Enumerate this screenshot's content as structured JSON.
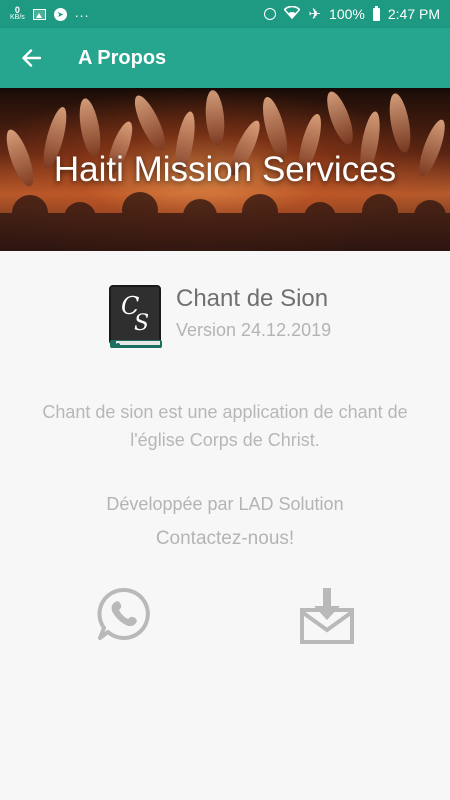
{
  "status_bar": {
    "kb_value": "0",
    "kb_unit": "KB/s",
    "more": "...",
    "battery": "100%",
    "time": "2:47 PM",
    "icons": [
      "network-speed-icon",
      "image-icon",
      "telegram-icon",
      "alarm-icon",
      "wifi-icon",
      "airplane-icon",
      "battery-icon"
    ]
  },
  "toolbar": {
    "back_icon": "arrow-left-icon",
    "title": "A Propos"
  },
  "banner": {
    "title": "Haiti Mission Services"
  },
  "app": {
    "logo_icon": "cs-book-logo-icon",
    "logo_letters": "CS",
    "name": "Chant de Sion",
    "version": "Version 24.12.2019"
  },
  "description": {
    "line1": "Chant de sion est une application de chant de",
    "line2": "l'église Corps de Christ."
  },
  "developer": "Développée par LAD Solution",
  "contact_label": "Contactez-nous!",
  "contact_buttons": {
    "whatsapp_icon": "whatsapp-icon",
    "mail_icon": "mail-download-icon"
  },
  "colors": {
    "status_bar": "#1f9a82",
    "toolbar": "#26a68e",
    "background": "#f7f7f7",
    "muted_text": "#b4b4b4",
    "icon_gray": "#b9b9b9"
  }
}
